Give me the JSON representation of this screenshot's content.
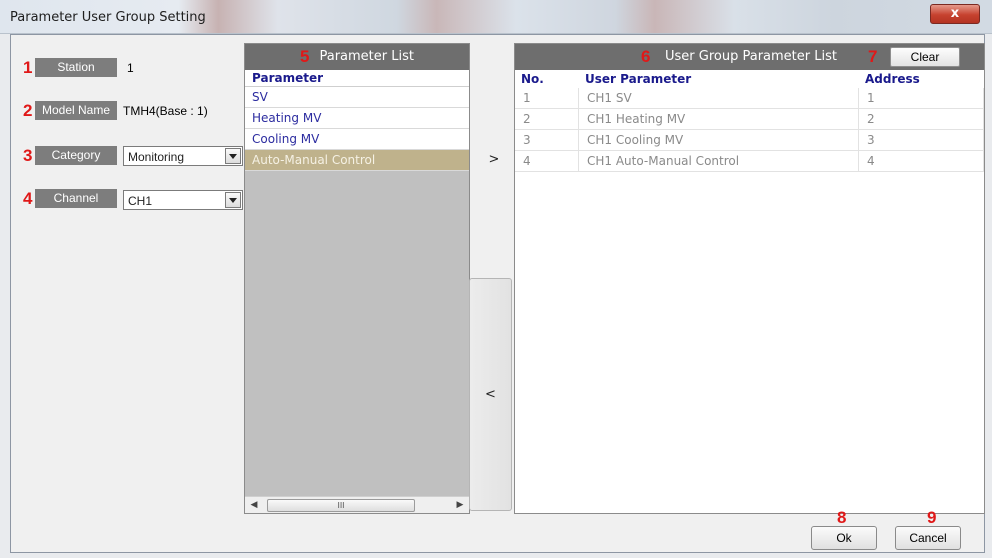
{
  "window": {
    "title": "Parameter User Group Setting",
    "close_label": "x"
  },
  "callouts": [
    "1",
    "2",
    "3",
    "4",
    "5",
    "6",
    "7",
    "8",
    "9"
  ],
  "left": {
    "station": {
      "label": "Station",
      "value": "1"
    },
    "model": {
      "label": "Model Name",
      "value": "TMH4(Base : 1)"
    },
    "category": {
      "label": "Category",
      "value": "Monitoring"
    },
    "channel": {
      "label": "Channel",
      "value": "CH1"
    }
  },
  "parameter_list": {
    "title": "Parameter List",
    "column": "Parameter",
    "items": [
      "SV",
      "Heating MV",
      "Cooling MV",
      "Auto-Manual Control"
    ],
    "scroll_thumb": "III"
  },
  "transfer": {
    "add": ">",
    "remove": "<"
  },
  "group_list": {
    "title": "User Group Parameter List",
    "clear": "Clear",
    "columns": [
      "No.",
      "User Parameter",
      "Address"
    ],
    "rows": [
      {
        "no": "1",
        "param": "CH1 SV",
        "addr": "1"
      },
      {
        "no": "2",
        "param": "CH1 Heating MV",
        "addr": "2"
      },
      {
        "no": "3",
        "param": "CH1 Cooling MV",
        "addr": "3"
      },
      {
        "no": "4",
        "param": "CH1 Auto-Manual Control",
        "addr": "4"
      }
    ]
  },
  "footer": {
    "ok": "Ok",
    "cancel": "Cancel"
  }
}
